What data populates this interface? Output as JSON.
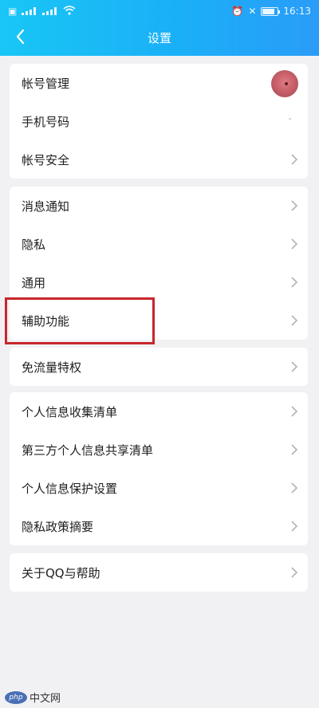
{
  "status_bar": {
    "left_text": "四 ᵃᵘ ꝑ",
    "time": "16:13"
  },
  "title_bar": {
    "title": "设置"
  },
  "groups": [
    {
      "items": [
        {
          "label": "帐号管理",
          "trailing": "avatar-icon"
        },
        {
          "label": "手机号码",
          "trailing": "ˇ"
        },
        {
          "label": "帐号安全",
          "trailing": "chevron-right-icon"
        }
      ]
    },
    {
      "items": [
        {
          "label": "消息通知",
          "trailing": "chevron-right-icon"
        },
        {
          "label": "隐私",
          "trailing": "chevron-right-icon"
        },
        {
          "label": "通用",
          "trailing": "chevron-right-icon"
        },
        {
          "label": "辅助功能",
          "trailing": "chevron-right-icon"
        }
      ]
    },
    {
      "items": [
        {
          "label": "免流量特权",
          "trailing": "chevron-right-icon"
        }
      ]
    },
    {
      "items": [
        {
          "label": "个人信息收集清单",
          "trailing": "chevron-right-icon"
        },
        {
          "label": "第三方个人信息共享清单",
          "trailing": "chevron-right-icon"
        },
        {
          "label": "个人信息保护设置",
          "trailing": "chevron-right-icon"
        },
        {
          "label": "隐私政策摘要",
          "trailing": "chevron-right-icon"
        }
      ]
    },
    {
      "items": [
        {
          "label": "关于QQ与帮助",
          "trailing": "chevron-right-icon"
        }
      ]
    }
  ],
  "watermark": {
    "logo": "php",
    "text": "中文网"
  },
  "colors": {
    "header_start": "#19c6f6",
    "header_end": "#2a9cf8",
    "background": "#f1f1f4",
    "highlight": "#c8262b"
  }
}
